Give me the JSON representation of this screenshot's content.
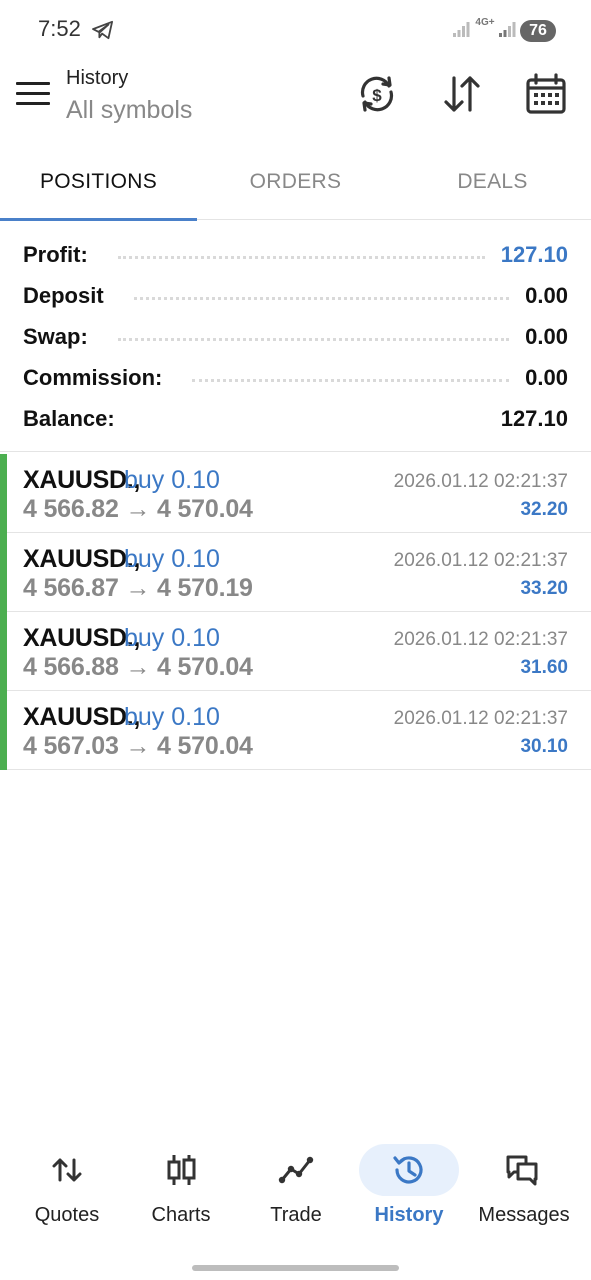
{
  "status_bar": {
    "time": "7:52",
    "network": "4G+",
    "battery": "76"
  },
  "app_bar": {
    "title": "History",
    "subtitle": "All symbols"
  },
  "tabs": [
    {
      "label": "POSITIONS",
      "active": true
    },
    {
      "label": "ORDERS",
      "active": false
    },
    {
      "label": "DEALS",
      "active": false
    }
  ],
  "summary": [
    {
      "label": "Profit:",
      "value": "127.10"
    },
    {
      "label": "Deposit",
      "value": "0.00"
    },
    {
      "label": "Swap:",
      "value": "0.00"
    },
    {
      "label": "Commission:",
      "value": "0.00"
    },
    {
      "label": "Balance:",
      "value": "127.10"
    }
  ],
  "deals": [
    {
      "symbol": "XAUUSD.,",
      "side": "buy 0.10",
      "prices": "4 566.82 → 4 570.04",
      "time": "2026.01.12 02:21:37",
      "profit": "32.20"
    },
    {
      "symbol": "XAUUSD.,",
      "side": "buy 0.10",
      "prices": "4 566.87 → 4 570.19",
      "time": "2026.01.12 02:21:37",
      "profit": "33.20"
    },
    {
      "symbol": "XAUUSD.,",
      "side": "buy 0.10",
      "prices": "4 566.88 → 4 570.04",
      "time": "2026.01.12 02:21:37",
      "profit": "31.60"
    },
    {
      "symbol": "XAUUSD.,",
      "side": "buy 0.10",
      "prices": "4 567.03 → 4 570.04",
      "time": "2026.01.12 02:21:37",
      "profit": "30.10"
    }
  ],
  "bottom_nav": [
    {
      "label": "Quotes",
      "icon": "quotes-arrows-icon",
      "active": false
    },
    {
      "label": "Charts",
      "icon": "candlestick-icon",
      "active": false
    },
    {
      "label": "Trade",
      "icon": "trend-line-icon",
      "active": false
    },
    {
      "label": "History",
      "icon": "history-clock-icon",
      "active": true
    },
    {
      "label": "Messages",
      "icon": "chat-bubbles-icon",
      "active": false
    }
  ],
  "colors": {
    "accent": "#3b78c5",
    "buy_bar": "#4caf50",
    "muted": "#888888"
  }
}
